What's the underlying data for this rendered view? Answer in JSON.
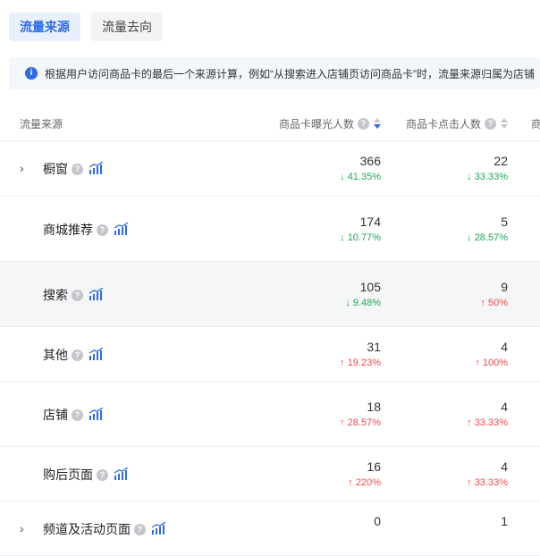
{
  "tabs": [
    {
      "label": "流量来源",
      "active": true
    },
    {
      "label": "流量去向",
      "active": false
    }
  ],
  "notice": "根据用户访问商品卡的最后一个来源计算，例如“从搜索进入店铺页访问商品卡”时，流量来源归属为店铺",
  "table": {
    "headers": {
      "source": "流量来源",
      "col1": "商品卡曝光人数",
      "col2": "商品卡点击人数",
      "col3": "商"
    },
    "rows": [
      {
        "name": "橱窗",
        "expandable": true,
        "highlight": false,
        "v1": "366",
        "c1": "41.35%",
        "d1": "down",
        "v2": "22",
        "c2": "33.33%",
        "d2": "down"
      },
      {
        "name": "商城推荐",
        "expandable": false,
        "highlight": false,
        "v1": "174",
        "c1": "10.77%",
        "d1": "down",
        "v2": "5",
        "c2": "28.57%",
        "d2": "down"
      },
      {
        "name": "搜索",
        "expandable": false,
        "highlight": true,
        "v1": "105",
        "c1": "9.48%",
        "d1": "down",
        "v2": "9",
        "c2": "50%",
        "d2": "up"
      },
      {
        "name": "其他",
        "expandable": false,
        "highlight": false,
        "v1": "31",
        "c1": "19.23%",
        "d1": "up",
        "v2": "4",
        "c2": "100%",
        "d2": "up"
      },
      {
        "name": "店铺",
        "expandable": false,
        "highlight": false,
        "v1": "18",
        "c1": "28.57%",
        "d1": "up",
        "v2": "4",
        "c2": "33.33%",
        "d2": "up"
      },
      {
        "name": "购后页面",
        "expandable": false,
        "highlight": false,
        "v1": "16",
        "c1": "220%",
        "d1": "up",
        "v2": "4",
        "c2": "33.33%",
        "d2": "up"
      },
      {
        "name": "频道及活动页面",
        "expandable": true,
        "highlight": false,
        "v1": "0",
        "c1": "",
        "d1": "",
        "v2": "1",
        "c2": "",
        "d2": ""
      }
    ]
  },
  "colors": {
    "accent": "#2e6be6",
    "down": "#1aaa55",
    "up": "#f04a4a"
  }
}
